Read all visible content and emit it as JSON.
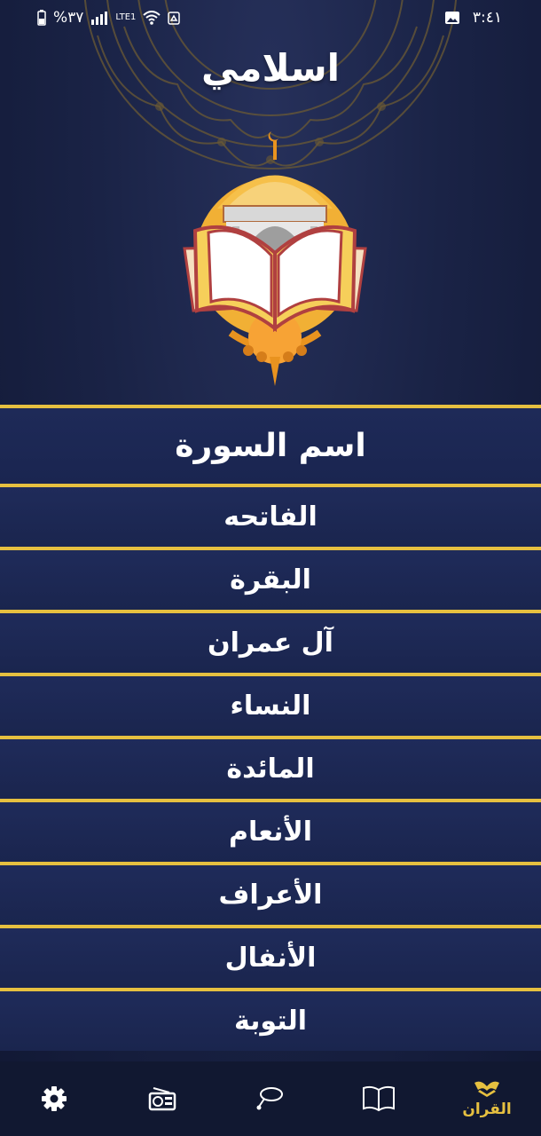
{
  "status_bar": {
    "time": "٣:٤١",
    "battery": "%٣٧",
    "network": "LTE1"
  },
  "app": {
    "title": "اسلامي"
  },
  "sura_list": {
    "header": "اسم السورة",
    "items": [
      {
        "name": "الفاتحه"
      },
      {
        "name": "البقرة"
      },
      {
        "name": "آل عمران"
      },
      {
        "name": "النساء"
      },
      {
        "name": "المائدة"
      },
      {
        "name": "الأنعام"
      },
      {
        "name": "الأعراف"
      },
      {
        "name": "الأنفال"
      },
      {
        "name": "التوبة"
      }
    ]
  },
  "bottom_nav": {
    "quran_label": "القران",
    "active_tab": "quran",
    "icons": [
      "quran-icon",
      "book-icon",
      "sebha-icon",
      "radio-icon",
      "settings-icon"
    ]
  },
  "colors": {
    "accent_gold": "#e6c040",
    "background": "#1a2346",
    "nav_background": "#111831"
  }
}
